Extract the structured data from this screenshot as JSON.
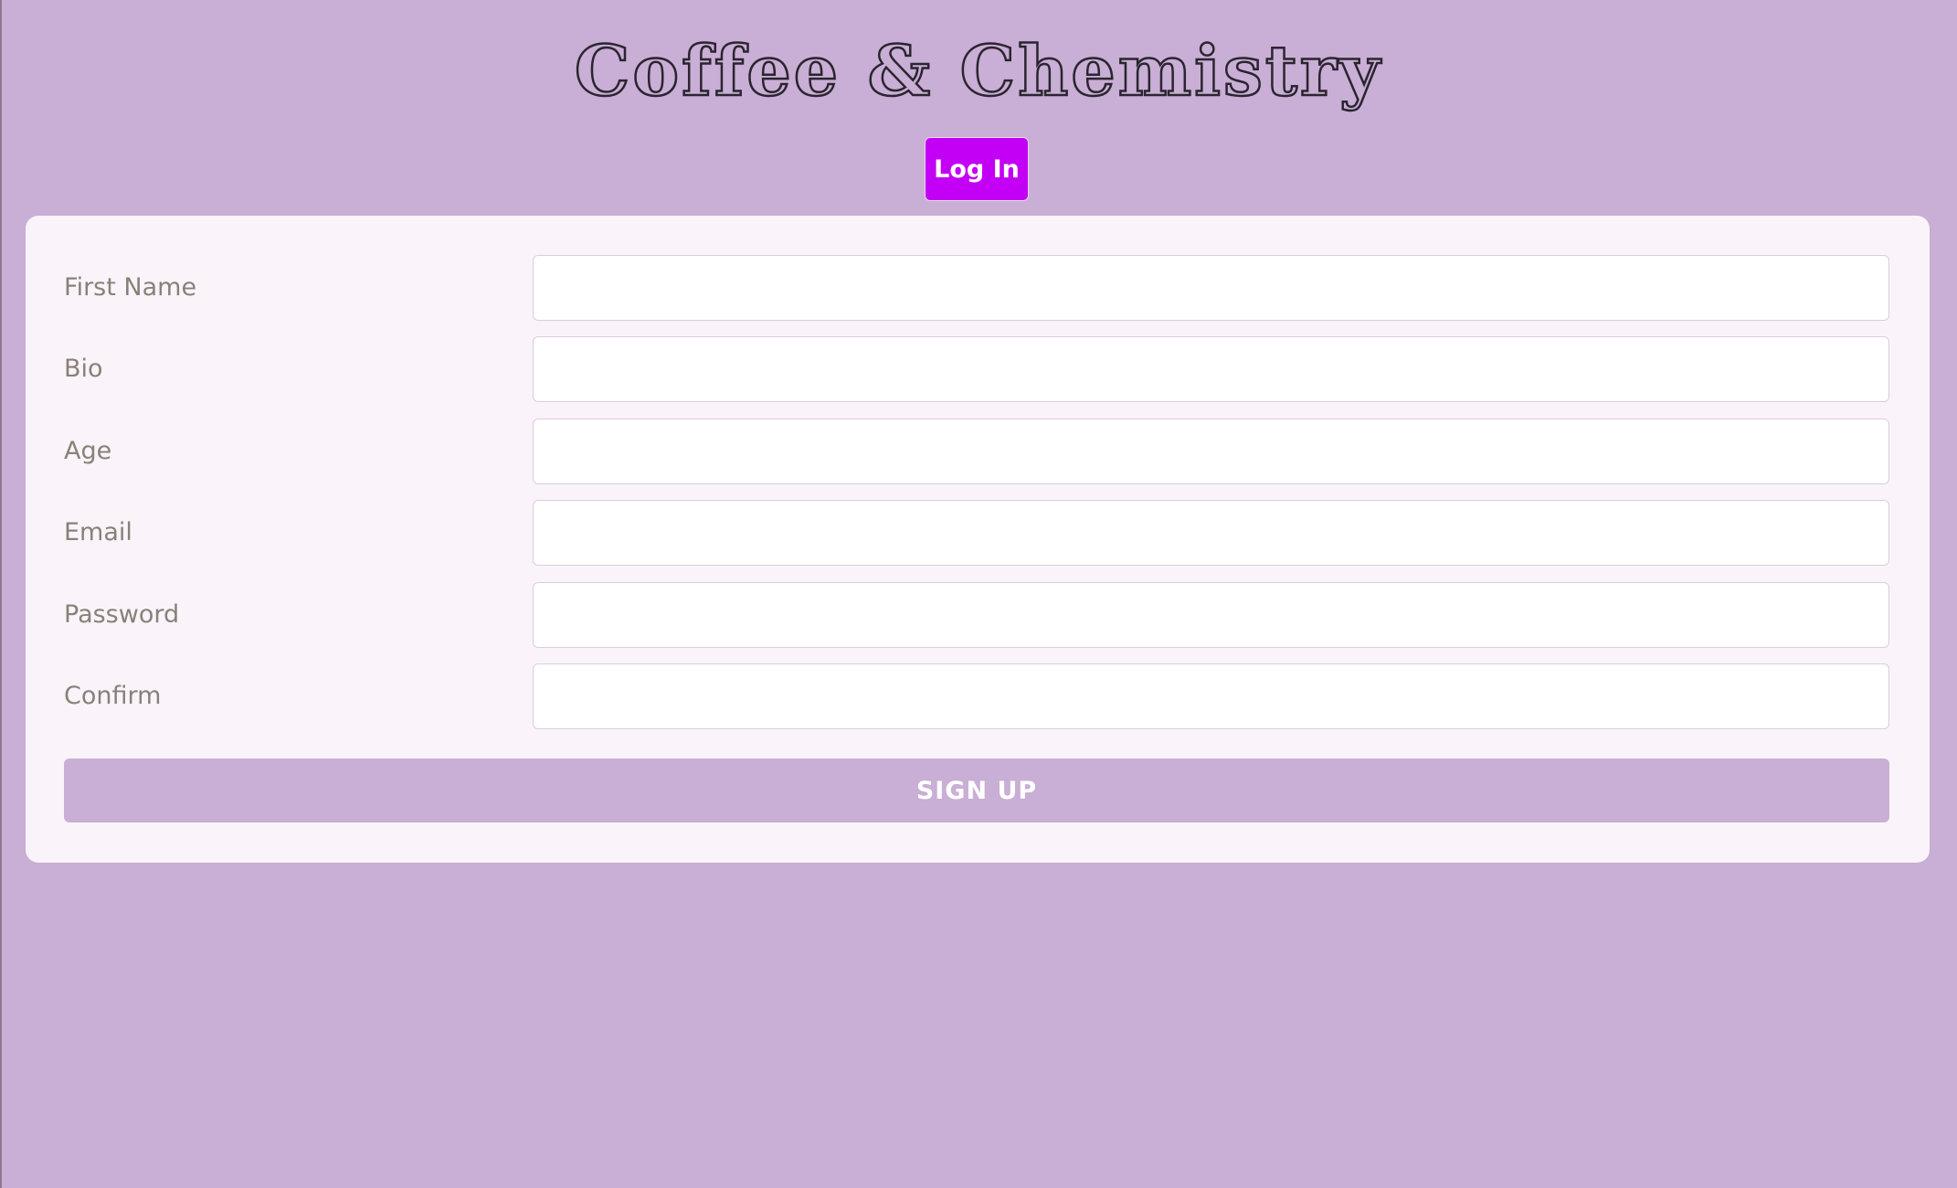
{
  "header": {
    "title": "Coffee & Chemistry",
    "login_label": "Log In"
  },
  "form": {
    "fields": [
      {
        "label": "First Name",
        "value": "",
        "placeholder": ""
      },
      {
        "label": "Bio",
        "value": "",
        "placeholder": ""
      },
      {
        "label": "Age",
        "value": "",
        "placeholder": ""
      },
      {
        "label": "Email",
        "value": "",
        "placeholder": ""
      },
      {
        "label": "Password",
        "value": "",
        "placeholder": ""
      },
      {
        "label": "Confirm",
        "value": "",
        "placeholder": ""
      }
    ],
    "submit_label": "SIGN UP"
  },
  "colors": {
    "page_background": "#c9aed5",
    "login_button": "#c300f5",
    "card_background": "#faf4fa",
    "signup_button": "#c9aed5",
    "label_text": "#8a8078"
  }
}
